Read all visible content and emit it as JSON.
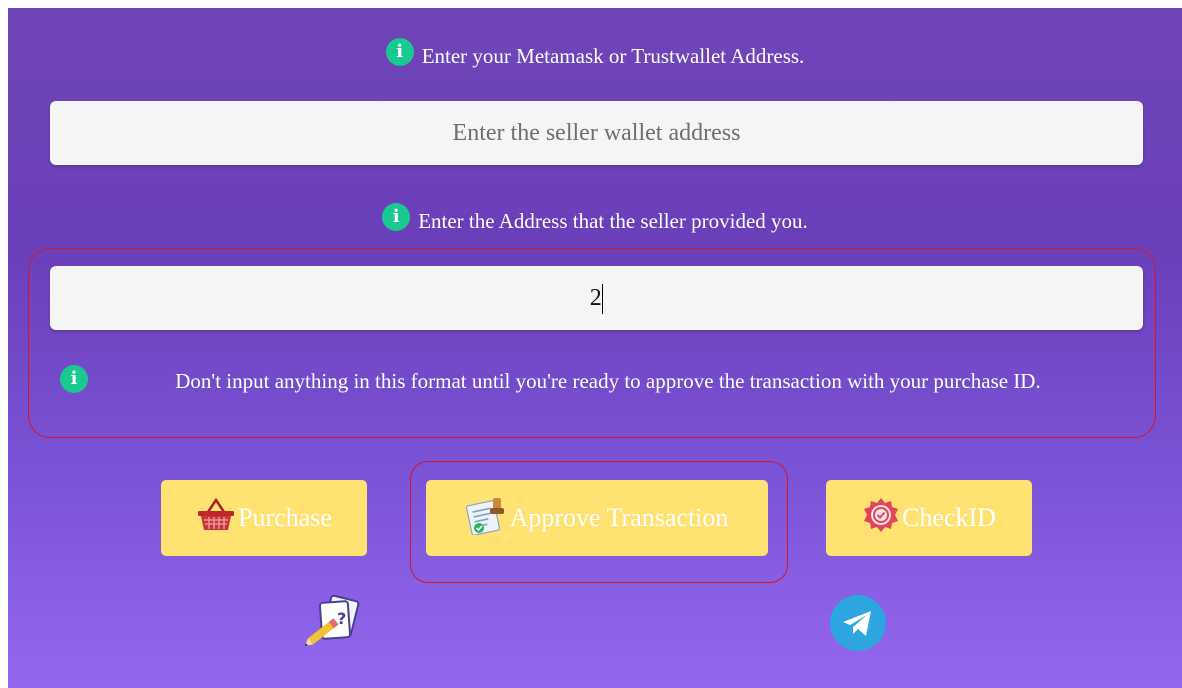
{
  "info": {
    "line1": "Enter your Metamask or Trustwallet Address.",
    "line2": "Enter the Address that the seller provided you.",
    "line3": "Don't input anything in this format until you're ready to approve the transaction with your purchase ID.",
    "icon": "info-icon",
    "icon_glyph": "i"
  },
  "fields": {
    "seller_address_placeholder": "Enter the seller wallet address",
    "seller_address_value": "",
    "provided_address_value": "2"
  },
  "buttons": {
    "purchase_label": "Purchase",
    "approve_label": "Approve Transaction",
    "checkid_label": "CheckID"
  },
  "icons": {
    "purchase": "basket-icon",
    "approve": "document-stamp-icon",
    "checkid": "badge-icon",
    "notes": "pencil-paper-icon",
    "telegram": "telegram-icon"
  },
  "colors": {
    "accent_button": "#ffe271",
    "info_green": "#19c98f",
    "highlight_red": "#d3162a",
    "telegram_blue": "#2ca5e0"
  }
}
